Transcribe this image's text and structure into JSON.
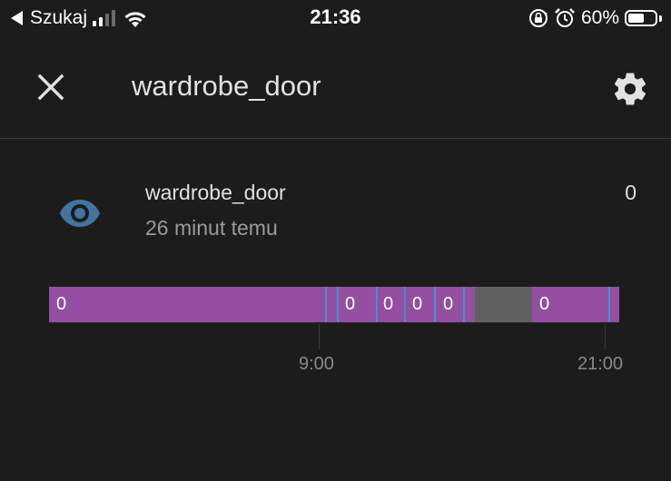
{
  "status_bar": {
    "carrier": "Szukaj",
    "time": "21:36",
    "battery": "60%",
    "battery_level": 0.6,
    "icons": [
      "back-arrow-icon",
      "signal-icon",
      "wifi-icon",
      "orientation-lock-icon",
      "alarm-icon",
      "battery-icon"
    ]
  },
  "header": {
    "title": "wardrobe_door",
    "close_icon": "close-icon",
    "settings_icon": "gear-icon"
  },
  "entity": {
    "name": "wardrobe_door",
    "last_changed": "26 minut temu",
    "state": "0",
    "icon": "eye-icon",
    "icon_color": "#44739e"
  },
  "timeline": {
    "segment_color": "#944fa3",
    "unavailable_color": "#616161",
    "change_color": "#4a90c8",
    "segment_labels": [
      "0",
      "0",
      "0",
      "0",
      "0",
      "0"
    ],
    "axis_labels": [
      "9:00",
      "21:00"
    ]
  }
}
